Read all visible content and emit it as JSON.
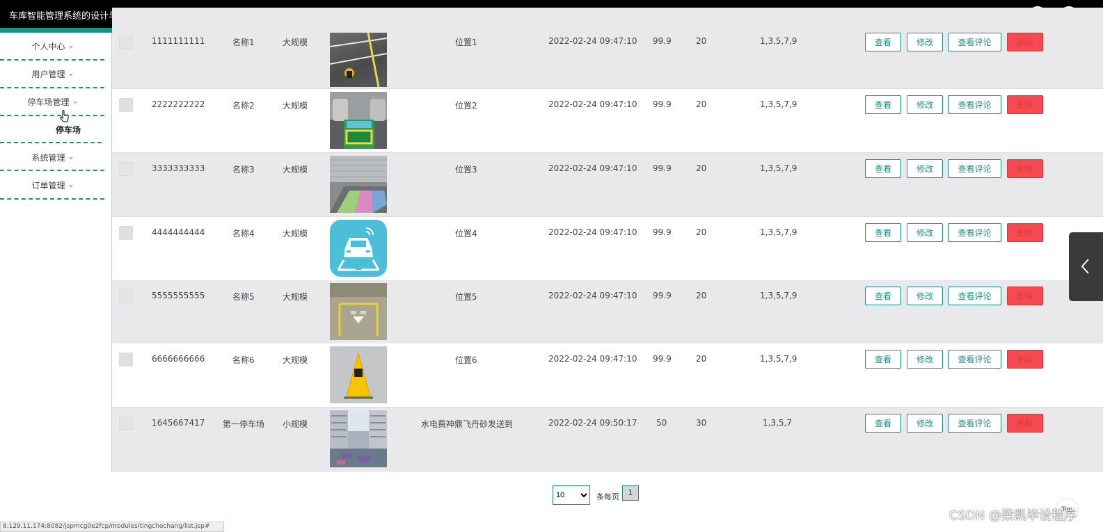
{
  "app": {
    "title": "车库智能管理系统的设计与实现"
  },
  "header_icons": [
    "fullscreen-exit-icon",
    "user-icon"
  ],
  "sidebar": {
    "items": [
      {
        "label": "个人中心"
      },
      {
        "label": "用户管理"
      },
      {
        "label": "停车场管理"
      },
      {
        "label": "系统管理"
      },
      {
        "label": "订单管理"
      }
    ],
    "active_subitem": "停车场"
  },
  "table": {
    "actions": {
      "view": "查看",
      "edit": "修改",
      "comments": "查看评论",
      "delete": "删除"
    },
    "rows": [
      {
        "id": "1111111111",
        "name": "名称1",
        "scale": "大规模",
        "location": "位置1",
        "time": "2022-02-24 09:47:10",
        "price": "99.9",
        "spaces": "20",
        "days": "1,3,5,7,9"
      },
      {
        "id": "2222222222",
        "name": "名称2",
        "scale": "大规模",
        "location": "位置2",
        "time": "2022-02-24 09:47:10",
        "price": "99.9",
        "spaces": "20",
        "days": "1,3,5,7,9"
      },
      {
        "id": "3333333333",
        "name": "名称3",
        "scale": "大规模",
        "location": "位置3",
        "time": "2022-02-24 09:47:10",
        "price": "99.9",
        "spaces": "20",
        "days": "1,3,5,7,9"
      },
      {
        "id": "4444444444",
        "name": "名称4",
        "scale": "大规模",
        "location": "位置4",
        "time": "2022-02-24 09:47:10",
        "price": "99.9",
        "spaces": "20",
        "days": "1,3,5,7,9"
      },
      {
        "id": "5555555555",
        "name": "名称5",
        "scale": "大规模",
        "location": "位置5",
        "time": "2022-02-24 09:47:10",
        "price": "99.9",
        "spaces": "20",
        "days": "1,3,5,7,9"
      },
      {
        "id": "6666666666",
        "name": "名称6",
        "scale": "大规模",
        "location": "位置6",
        "time": "2022-02-24 09:47:10",
        "price": "99.9",
        "spaces": "20",
        "days": "1,3,5,7,9"
      },
      {
        "id": "1645667417",
        "name": "第一停车场",
        "scale": "小规模",
        "location": "水电费神鼎飞丹砂发送到",
        "time": "2022-02-24 09:50:17",
        "price": "50",
        "spaces": "30",
        "days": "1,3,5,7"
      }
    ]
  },
  "pagination": {
    "page_size": "10",
    "page_size_options": [
      "10"
    ],
    "per_page_label": "条每页",
    "current_page": "1"
  },
  "top_button": "Top",
  "watermark": "CSDN @梁凯毕设程序",
  "status_url": "8.129.11.174:8082/jspmcg0e2fcp/modules/tingchechang/list.jsp#"
}
